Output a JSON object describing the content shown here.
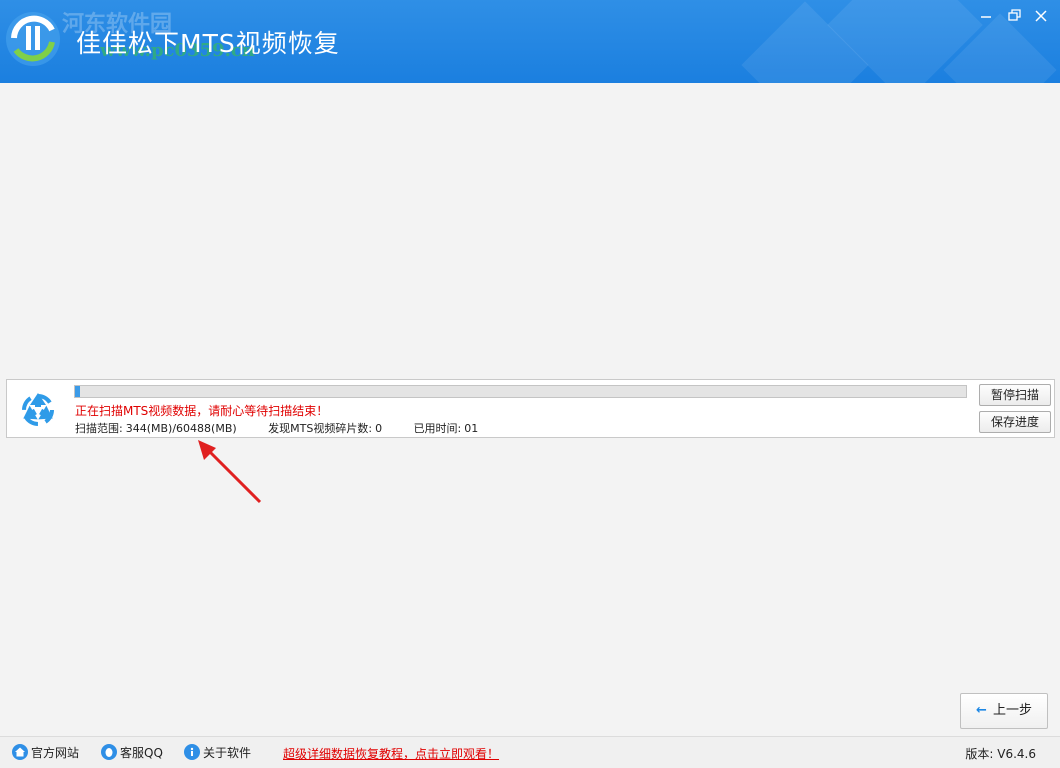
{
  "window": {
    "title": "佳佳松下MTS视频恢复",
    "watermark_top": "河东软件园",
    "watermark_url": "www.pc0359.cn",
    "accent_color": "#1e82e0"
  },
  "scan": {
    "progress_fraction": 0.0057,
    "status_text": "正在扫描MTS视频数据，请耐心等待扫描结束！",
    "range_label": "扫描范围:",
    "range_value": "344(MB)/60488(MB)",
    "found_label": "发现MTS视频碎片数:",
    "found_value": "0",
    "elapsed_label": "已用时间:",
    "elapsed_value": "01",
    "pause_button": "暂停扫描",
    "save_button": "保存进度",
    "status_color": "#e00000"
  },
  "nav": {
    "back_arrow": "←",
    "back_button": "上一步"
  },
  "footer": {
    "website": "官方网站",
    "qq": "客服QQ",
    "about": "关于软件",
    "tutorial_link": "超级详细数据恢复教程，点击立即观看！",
    "version": "版本: V6.4.6"
  },
  "icons": {
    "home": "home-icon",
    "qq": "qq-penguin-icon",
    "about": "info-icon",
    "scan": "recycle-icon",
    "min": "minimize-icon",
    "max": "restore-icon",
    "close": "close-icon"
  }
}
